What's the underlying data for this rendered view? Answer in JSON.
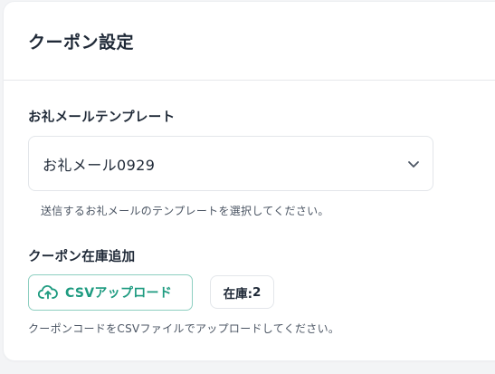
{
  "card": {
    "title": "クーポン設定"
  },
  "template": {
    "label": "お礼メールテンプレート",
    "selected_value": "お礼メール0929",
    "help": "送信するお礼メールのテンプレートを選択してください。"
  },
  "stock": {
    "label": "クーポン在庫追加",
    "upload_label": "CSVアップロード",
    "badge_label": "在庫: ",
    "badge_count": "2",
    "help": "クーポンコードをCSVファイルでアップロードしてください。"
  },
  "icons": {
    "chevron": "chevron-down-icon",
    "upload": "cloud-upload-icon"
  },
  "colors": {
    "accent": "#1e9b80",
    "accent_border": "#8ecfc1"
  }
}
